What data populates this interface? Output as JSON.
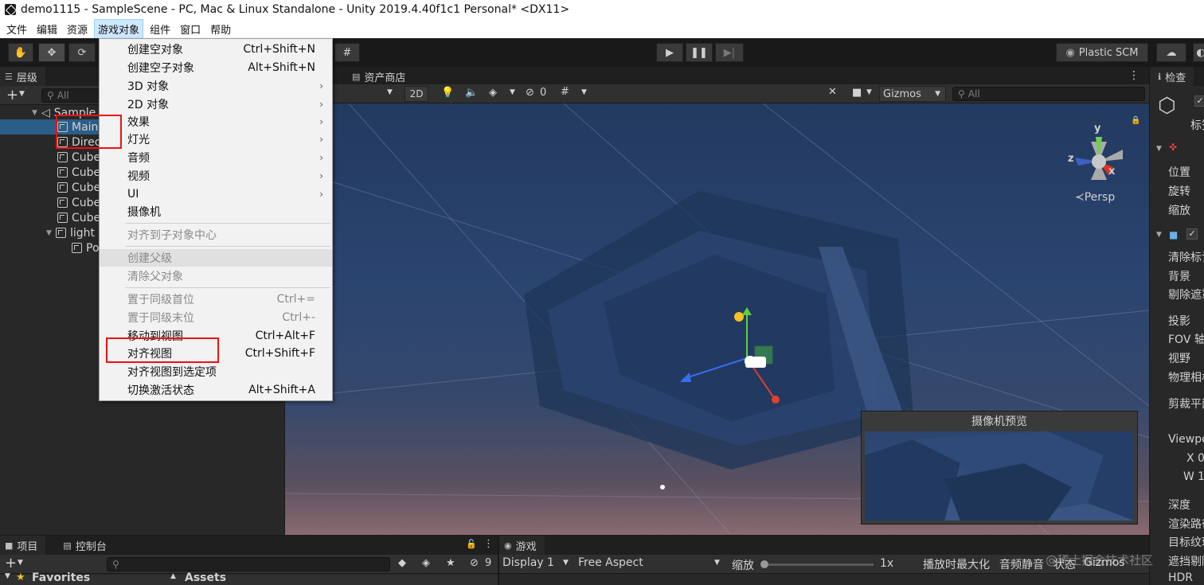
{
  "window": {
    "title": "demo1115 - SampleScene - PC, Mac & Linux Standalone - Unity 2019.4.40f1c1 Personal* <DX11>"
  },
  "menubar": {
    "items": [
      "文件",
      "编辑",
      "资源",
      "游戏对象",
      "组件",
      "窗口",
      "帮助"
    ],
    "active": "游戏对象"
  },
  "toolbar": {
    "plastic": "Plastic SCM",
    "icons": [
      "hand-icon",
      "move-icon",
      "rotate-icon",
      "play-icon",
      "pause-icon",
      "step-icon",
      "cloud-icon"
    ]
  },
  "hierarchy": {
    "tab": "层级",
    "add": "+",
    "search_placeholder": "All",
    "rows": [
      {
        "label": "Sample",
        "indent": 0,
        "kind": "scene"
      },
      {
        "label": "Main",
        "indent": 1,
        "kind": "obj",
        "selected": true
      },
      {
        "label": "Direc",
        "indent": 1,
        "kind": "obj"
      },
      {
        "label": "Cube",
        "indent": 1,
        "kind": "obj"
      },
      {
        "label": "Cube",
        "indent": 1,
        "kind": "obj"
      },
      {
        "label": "Cube",
        "indent": 1,
        "kind": "obj"
      },
      {
        "label": "Cube",
        "indent": 1,
        "kind": "obj"
      },
      {
        "label": "Cube",
        "indent": 1,
        "kind": "obj"
      },
      {
        "label": "light",
        "indent": 1,
        "kind": "fold"
      },
      {
        "label": "Po",
        "indent": 2,
        "kind": "obj"
      }
    ]
  },
  "context_menu": {
    "items": [
      {
        "label": "创建空对象",
        "shortcut": "Ctrl+Shift+N"
      },
      {
        "label": "创建空子对象",
        "shortcut": "Alt+Shift+N"
      },
      {
        "label": "3D 对象",
        "submenu": true
      },
      {
        "label": "2D 对象",
        "submenu": true
      },
      {
        "label": "效果",
        "submenu": true
      },
      {
        "label": "灯光",
        "submenu": true
      },
      {
        "label": "音频",
        "submenu": true
      },
      {
        "label": "视频",
        "submenu": true
      },
      {
        "label": "UI",
        "submenu": true
      },
      {
        "label": "摄像机"
      },
      {
        "sep": true
      },
      {
        "label": "对齐到子对象中心",
        "disabled": true
      },
      {
        "sep": true
      },
      {
        "label": "创建父级",
        "disabled": true,
        "highlight": true
      },
      {
        "label": "清除父对象",
        "disabled": true
      },
      {
        "sep": true
      },
      {
        "label": "置于同级首位",
        "shortcut": "Ctrl+=",
        "disabled": true
      },
      {
        "label": "置于同级末位",
        "shortcut": "Ctrl+-",
        "disabled": true
      },
      {
        "label": "移动到视图",
        "shortcut": "Ctrl+Alt+F"
      },
      {
        "label": "对齐视图",
        "shortcut": "Ctrl+Shift+F"
      },
      {
        "label": "对齐视图到选定项"
      },
      {
        "label": "切换激活状态",
        "shortcut": "Alt+Shift+A"
      }
    ]
  },
  "scene": {
    "asset_store_tab": "资产商店",
    "mode_2d": "2D",
    "hidden_count": "0",
    "gizmos": "Gizmos",
    "search_placeholder": "All",
    "persp": "Persp",
    "axis_x": "x",
    "axis_y": "y",
    "axis_z": "z",
    "camera_preview_title": "摄像机预览"
  },
  "inspector": {
    "tab": "检查",
    "labels": [
      "标签",
      "位置",
      "旋转",
      "缩放",
      "清除标记",
      "背景",
      "剔除遮罩",
      "投影",
      "FOV 轴",
      "视野",
      "物理相机",
      "剪裁平面",
      "Viewport",
      "X",
      "W",
      "深度",
      "渲染路径",
      "目标纹理",
      "遮挡剔除",
      "HDR"
    ],
    "x_value": "0",
    "w_value": "1"
  },
  "bottom": {
    "project_tab": "项目",
    "console_tab": "控制台",
    "favorites": "Favorites",
    "assets": "Assets",
    "count": "9",
    "game_tab": "游戏",
    "display": "Display 1",
    "aspect": "Free Aspect",
    "scale_label": "缩放",
    "scale_value": "1x",
    "maximize": "播放时最大化",
    "mute": "音频静音",
    "stats": "状态",
    "gizmos": "Gizmos",
    "watermark": "@稀土掘金技术社区"
  },
  "colors": {
    "accent": "#2c5d87",
    "annotation": "#ee1111"
  }
}
